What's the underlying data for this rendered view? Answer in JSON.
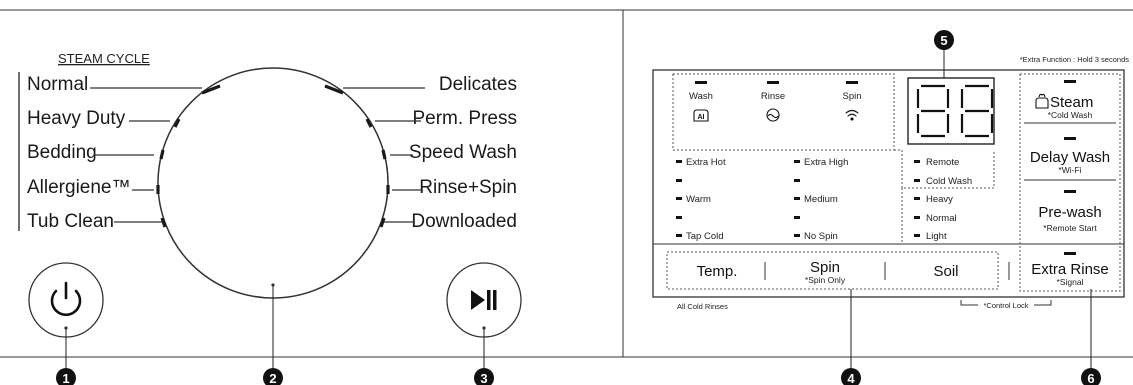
{
  "cycle_panel": {
    "heading": "STEAM CYCLE",
    "left_cycles": [
      "Normal",
      "Heavy Duty",
      "Bedding",
      "Allergiene™",
      "Tub Clean"
    ],
    "right_cycles": [
      "Delicates",
      "Perm. Press",
      "Speed Wash",
      "Rinse+Spin",
      "Downloaded"
    ],
    "power_icon": "power-icon",
    "start_pause_icon": "play-pause-icon"
  },
  "control_panel": {
    "extra_function_note": "*Extra Function : Hold 3 seconds",
    "status": {
      "labels": [
        "Wash",
        "Rinse",
        "Spin"
      ],
      "icons": [
        "wash-status-icon",
        "rinse-status-icon",
        "spin-status-icon"
      ]
    },
    "display_digits": "88",
    "temp_options": [
      "Extra Hot",
      "",
      "Warm",
      "",
      "Tap Cold"
    ],
    "spin_options": [
      "Extra High",
      "",
      "Medium",
      "",
      "No Spin"
    ],
    "remote_options": [
      "Remote",
      "Cold Wash"
    ],
    "soil_options": [
      "Heavy",
      "Normal",
      "Light"
    ],
    "option_buttons": [
      {
        "label": "Steam",
        "sub": "*Cold Wash",
        "icon": "steam-icon"
      },
      {
        "label": "Delay Wash",
        "sub": "*Wi-Fi"
      },
      {
        "label": "Pre-wash",
        "sub": "*Remote Start"
      },
      {
        "label": "Extra Rinse",
        "sub": "*Signal"
      }
    ],
    "bottom_buttons": [
      {
        "label": "Temp.",
        "sub": ""
      },
      {
        "label": "Spin",
        "sub": "*Spin Only"
      },
      {
        "label": "Soil",
        "sub": ""
      }
    ],
    "all_cold_rinses": "All Cold Rinses",
    "control_lock": "*Control Lock"
  },
  "callouts": [
    "1",
    "2",
    "3",
    "4",
    "5",
    "6"
  ]
}
